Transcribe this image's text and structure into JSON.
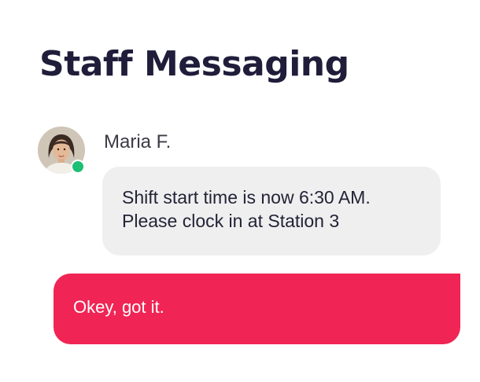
{
  "header": {
    "title": "Staff Messaging"
  },
  "conversation": {
    "sender": {
      "name": "Maria F.",
      "status": "online",
      "avatar_icon": "user-avatar-photo"
    },
    "incoming_message": {
      "lines": [
        "Shift start time is now 6:30 AM.",
        "Please clock in at Station 3"
      ]
    },
    "outgoing_message": {
      "text": "Okey, got it."
    }
  },
  "colors": {
    "title": "#1f1d3a",
    "incoming_bubble": "#efeff0",
    "outgoing_bubble": "#f02555",
    "status_online": "#1dbf73"
  }
}
